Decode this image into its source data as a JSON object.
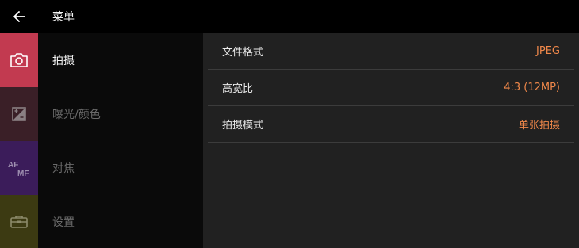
{
  "header": {
    "title": "菜单"
  },
  "categories": [
    {
      "icon": "camera-icon",
      "label": "拍摄",
      "tile_color": "#c23a50",
      "label_color": "#f2f2f2",
      "active": true
    },
    {
      "icon": "exposure-icon",
      "label": "曝光/颜色",
      "tile_color": "#3a1f27",
      "label_color": "#6a6a6a",
      "active": false
    },
    {
      "icon": "af-mf-icon",
      "icon_text_top": "AF",
      "icon_text_bottom": "MF",
      "label": "对焦",
      "tile_color": "#3b1c5a",
      "label_color": "#6a6a6a",
      "active": false
    },
    {
      "icon": "toolbox-icon",
      "label": "设置",
      "tile_color": "#3c3a12",
      "label_color": "#6a6a6a",
      "active": false
    }
  ],
  "settings": [
    {
      "label": "文件格式",
      "value": "JPEG"
    },
    {
      "label": "高宽比",
      "value": "4:3 (12MP)"
    },
    {
      "label": "拍摄模式",
      "value": "单张拍摄"
    }
  ],
  "colors": {
    "accent": "#f0884a"
  }
}
